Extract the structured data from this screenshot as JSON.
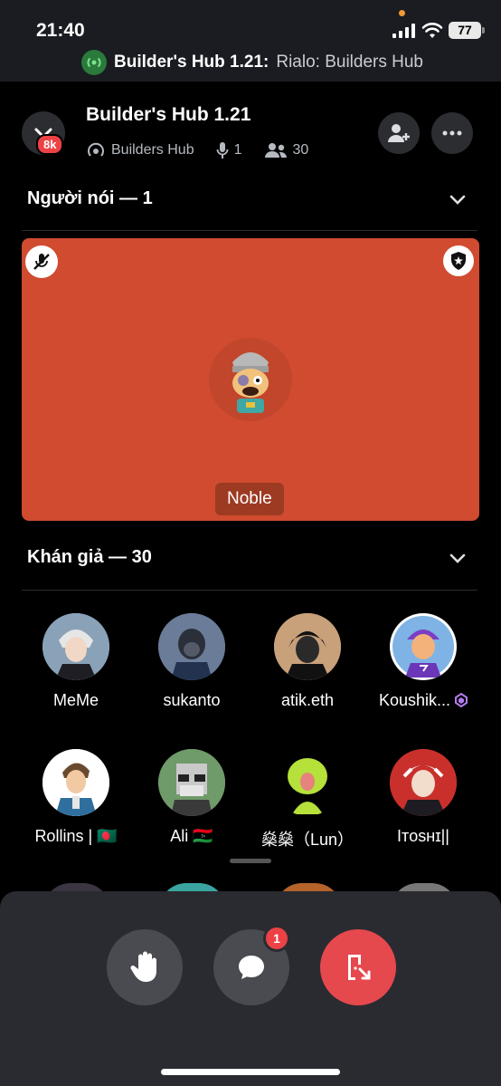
{
  "status_bar": {
    "time": "21:40",
    "battery": "77"
  },
  "stage_banner": {
    "title": "Builder's Hub 1.21:",
    "subtitle": "Rialo: Builders Hub"
  },
  "header": {
    "title": "Builder's Hub 1.21",
    "server_badge": "8k",
    "channel": "Builders Hub",
    "speaker_count": "1",
    "listener_count": "30"
  },
  "speakers": {
    "heading": "Người nói — 1",
    "list": [
      {
        "name": "Noble",
        "card_color": "#d04b2f"
      }
    ]
  },
  "audience": {
    "heading": "Khán giả — 30",
    "members": [
      {
        "name": "MeMe",
        "color": "#8aa2b8"
      },
      {
        "name": "sukanto",
        "color": "#5a6a86"
      },
      {
        "name": "atik.eth",
        "color": "#c8a07a"
      },
      {
        "name": "Koushik...",
        "color": "#7fb3e6"
      },
      {
        "name": "Rollins | 🇧🇩",
        "color": "#ffffff"
      },
      {
        "name": "Ali 🇱🇾",
        "color": "#6f9a6a"
      },
      {
        "name": "燊燊（Lun）",
        "color": "#000000"
      },
      {
        "name": "Iᴛᴏsʜɪ||",
        "color": "#c9302c"
      }
    ]
  },
  "controls": {
    "chat_badge": "1"
  },
  "colors": {
    "leave": "#e5484d",
    "control_bg": "#4a4b50",
    "accent_green": "#2a7a3c"
  }
}
